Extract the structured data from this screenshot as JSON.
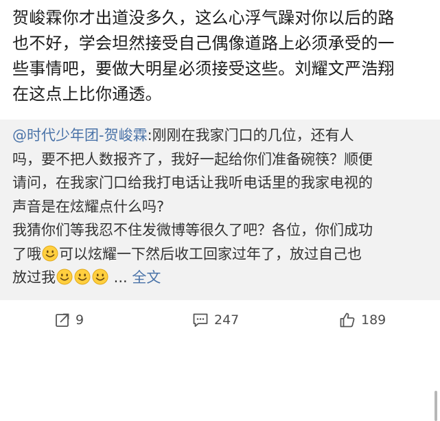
{
  "post": {
    "text": "贺峻霖你才出道没多久，这么心浮气躁对你以后的路\n也不好，学会坦然接受自己偶像道路上必须承受的一\n些事情吧，要做大明星必须接受这些。刘耀文严浩翔\n在这点上比你通透。"
  },
  "repost": {
    "mention": "@时代少年团-贺峻霖",
    "line1_rest": ":刚刚在我家门口的几位，还有人",
    "line2": "吗，要不把人数报齐了，我好一起给你们准备碗筷？顺便",
    "line3": "请问，在我家门口给我打电话让我听电话里的我家电视的",
    "line4": "声音是在炫耀点什么吗?",
    "line5": "我猜你们等我忍不住发微博等很久了吧？各位，你们成功",
    "line6a": "了哦",
    "line6b": "可以炫耀一下然后收工回家过年了，放过自己也",
    "line7": "放过我",
    "ellipsis": " ...",
    "full_text_link": "全文"
  },
  "actions": {
    "repost_count": "9",
    "comment_count": "247",
    "like_count": "189"
  },
  "icons": {
    "repost": "share-icon",
    "comment": "comment-icon",
    "like": "thumbs-up-icon",
    "emoji": "smile-emoji-icon"
  }
}
